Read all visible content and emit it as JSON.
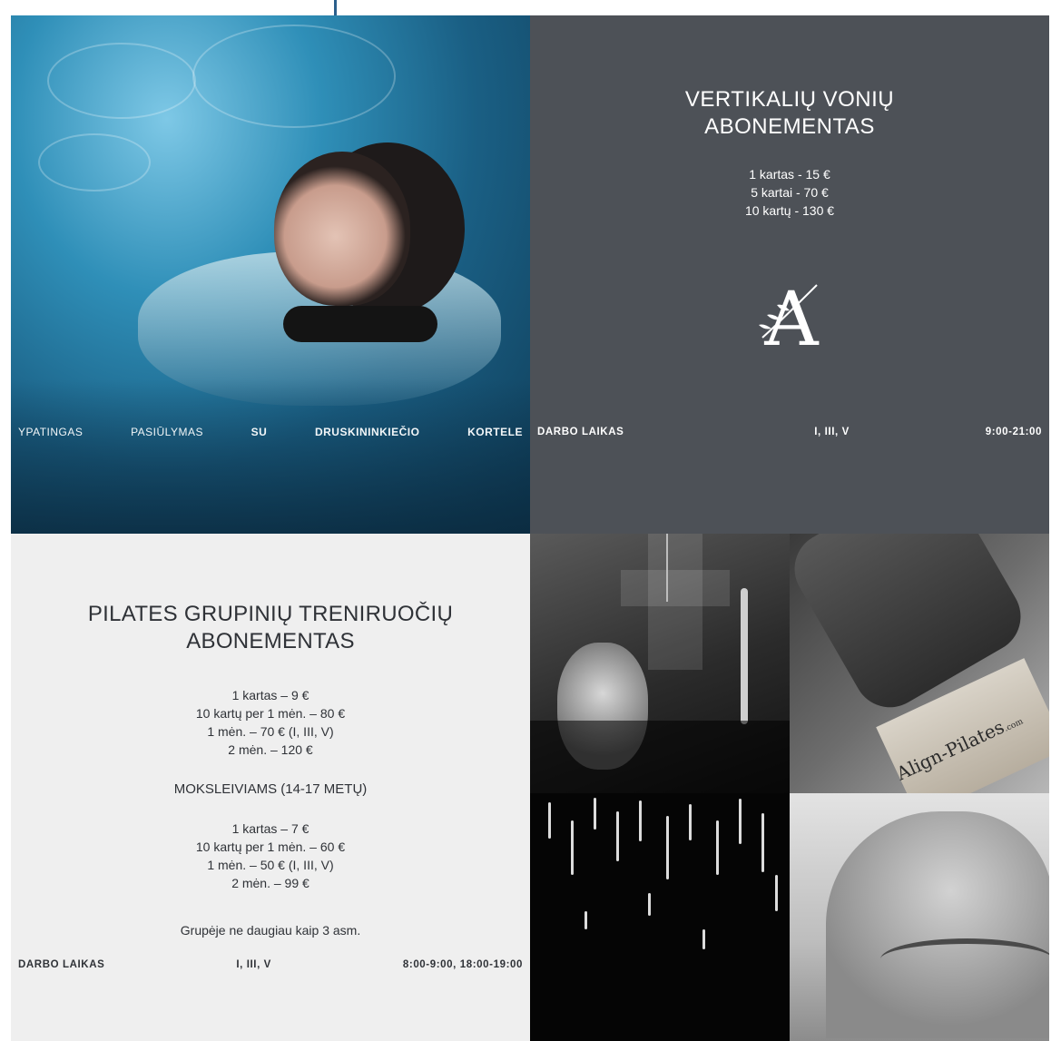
{
  "pool_panel": {
    "offer_words": [
      "YPATINGAS",
      "PASIŪLYMAS",
      "SU",
      "DRUSKININKIEČIO",
      "KORTELE"
    ]
  },
  "vonios_panel": {
    "title_line1": "VERTIKALIŲ VONIŲ",
    "title_line2": "ABONEMENTAS",
    "prices": [
      "1 kartas - 15 €",
      "5 kartai - 70 €",
      "10 kartų - 130 €"
    ],
    "logo_letter": "A",
    "hours_label": "DARBO LAIKAS",
    "hours_days": "I, III, V",
    "hours_time": "9:00-21:00"
  },
  "pilates_panel": {
    "title_line1": "PILATES GRUPINIŲ TRENIRUOČIŲ",
    "title_line2": "ABONEMENTAS",
    "prices": [
      "1 kartas – 9 €",
      "10 kartų per 1 mėn. – 80 €",
      "1 mėn. – 70 € (I, III, V)",
      "2 mėn. – 120 €"
    ],
    "students_heading": "MOKSLEIVIAMS (14-17 METŲ)",
    "student_prices": [
      "1 kartas – 7 €",
      "10 kartų per 1 mėn. – 60 €",
      "1 mėn. – 50 € (I, III, V)",
      "2 mėn. – 99 €"
    ],
    "group_note": "Grupėje ne daugiau kaip 3 asm.",
    "hours_label": "DARBO LAIKAS",
    "hours_days": "I, III, V",
    "hours_time": "8:00-9:00, 18:00-19:00"
  },
  "reformer_panel": {
    "brand": "Align-Pilates",
    "brand_suffix": ".com"
  },
  "colors": {
    "dark_panel": "#4d5157",
    "light_panel": "#efefef",
    "accent_line": "#2b5f8c"
  }
}
